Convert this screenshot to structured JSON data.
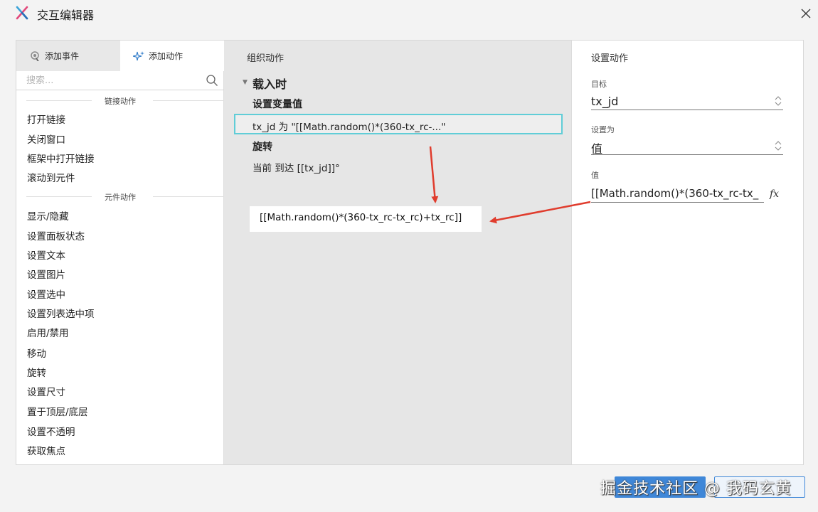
{
  "window": {
    "title": "交互编辑器"
  },
  "left_panel": {
    "tabs": [
      {
        "label": "添加事件",
        "icon": "cursor-gear-icon"
      },
      {
        "label": "添加动作",
        "icon": "sparkle-icon"
      }
    ],
    "search": {
      "placeholder": "搜索..."
    },
    "groups": [
      {
        "header": "链接动作",
        "items": [
          "打开链接",
          "关闭窗口",
          "框架中打开链接",
          "滚动到元件"
        ]
      },
      {
        "header": "元件动作",
        "items": [
          "显示/隐藏",
          "设置面板状态",
          "设置文本",
          "设置图片",
          "设置选中",
          "设置列表选中项",
          "启用/禁用",
          "移动",
          "旋转",
          "设置尺寸",
          "置于顶层/底层",
          "设置不透明",
          "获取焦点"
        ]
      }
    ]
  },
  "middle_panel": {
    "title": "组织动作",
    "event": "载入时",
    "cases": [
      {
        "label": "设置变量值",
        "action": "tx_jd 为 \"[[Math.random()*(360-tx_rc-...\""
      },
      {
        "label": "旋转",
        "action": "当前 到达 [[tx_jd]]°"
      }
    ],
    "callout": "[[Math.random()*(360-tx_rc-tx_rc)+tx_rc]]"
  },
  "right_panel": {
    "title": "设置动作",
    "target_label": "目标",
    "target_value": "tx_jd",
    "set_as_label": "设置为",
    "set_as_value": "值",
    "value_label": "值",
    "value": "[[Math.random()*(360-tx_rc-tx_",
    "fx_label": "fx"
  },
  "watermark": {
    "text": "掘金技术社区 @ 我码玄黄"
  },
  "colors": {
    "selected_border": "#60cdd7",
    "arrow": "#e03c2d",
    "middle_bg": "#e6e6e6",
    "watermark_blue": "#3f87d8"
  }
}
